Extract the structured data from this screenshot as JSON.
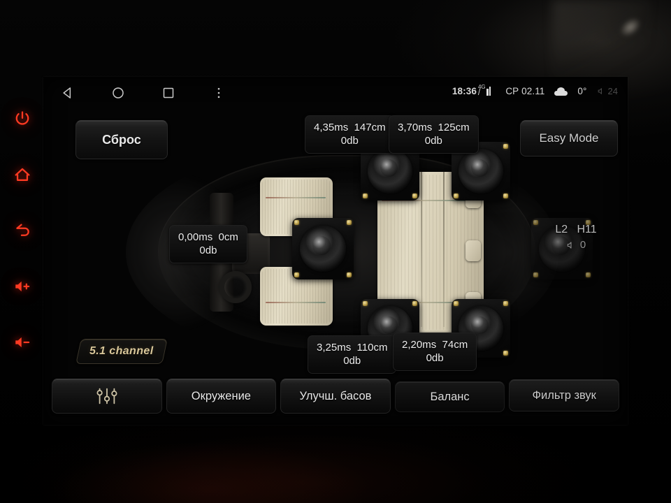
{
  "statusbar": {
    "time": "18:36",
    "network_tag": "4G",
    "date": "СР 02.11",
    "temperature": "0°",
    "volume": "24",
    "signal_icon": "signal-bars-icon",
    "weather_icon": "cloud-icon",
    "volume_icon": "volume-icon"
  },
  "navbar": {
    "back_icon": "back-triangle-icon",
    "home_icon": "home-circle-icon",
    "recents_icon": "recents-square-icon",
    "overflow_icon": "more-vertical-icon"
  },
  "hardware_keys": [
    {
      "name": "power",
      "icon": "power-icon"
    },
    {
      "name": "home",
      "icon": "home-icon"
    },
    {
      "name": "back",
      "icon": "back-arrow-icon"
    },
    {
      "name": "volume-up",
      "icon": "volume-up-icon"
    },
    {
      "name": "volume-down",
      "icon": "volume-down-icon"
    }
  ],
  "toolbar": {
    "reset_label": "Сброс",
    "easy_mode_label": "Easy Mode"
  },
  "channel_badge": "5.1 channel",
  "indicator": {
    "layer": "L2",
    "height": "H11",
    "volume_value": "0",
    "volume_icon": "speaker-icon"
  },
  "speakers": [
    {
      "position": "front-left",
      "delay": "4,35ms",
      "distance": "147cm",
      "gain": "0db"
    },
    {
      "position": "front-right",
      "delay": "3,70ms",
      "distance": "125cm",
      "gain": "0db"
    },
    {
      "position": "left-side",
      "delay": "0,00ms",
      "distance": "0cm",
      "gain": "0db"
    },
    {
      "position": "rear-left",
      "delay": "3,25ms",
      "distance": "110cm",
      "gain": "0db"
    },
    {
      "position": "rear-right",
      "delay": "2,20ms",
      "distance": "74cm",
      "gain": "0db"
    }
  ],
  "tabs": [
    {
      "label": "",
      "icon": "equalizer-icon",
      "selected": true
    },
    {
      "label": "Окружение",
      "icon": "",
      "selected": false
    },
    {
      "label": "Улучш. басов",
      "icon": "",
      "selected": false
    },
    {
      "label": "Баланс",
      "icon": "",
      "selected": false
    },
    {
      "label": "Фильтр звук",
      "icon": "",
      "selected": false
    }
  ],
  "colors": {
    "hardware_key_red": "#ff3a22",
    "badge_gold": "#d9c79a",
    "text_primary": "#ececec",
    "screen_bg": "#040404"
  }
}
